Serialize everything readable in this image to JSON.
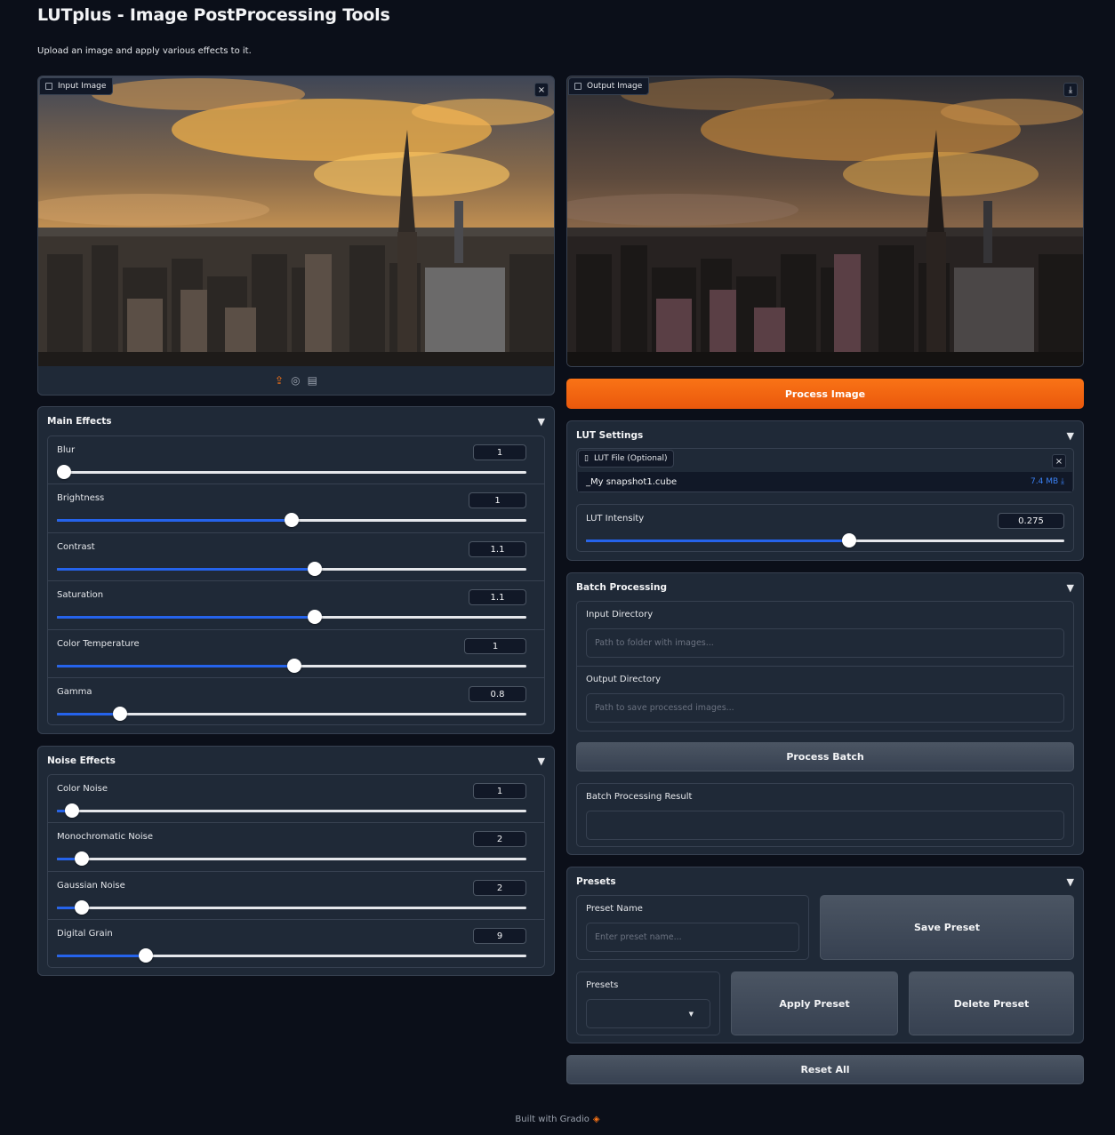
{
  "header": {
    "title": "LUTplus - Image PostProcessing Tools",
    "subtitle": "Upload an image and apply various effects to it."
  },
  "input_image": {
    "label": "Input Image",
    "close_icon": "×"
  },
  "output_image": {
    "label": "Output Image",
    "download_icon": "⤓"
  },
  "upload_icons": [
    "upload-icon",
    "webcam-icon",
    "clipboard-icon"
  ],
  "process_image_label": "Process Image",
  "main_effects": {
    "title": "Main Effects",
    "sliders": [
      {
        "label": "Blur",
        "value": "1",
        "fraction": 0.0
      },
      {
        "label": "Brightness",
        "value": "1",
        "fraction": 0.5
      },
      {
        "label": "Contrast",
        "value": "1.1",
        "fraction": 0.55
      },
      {
        "label": "Saturation",
        "value": "1.1",
        "fraction": 0.55
      },
      {
        "label": "Color Temperature",
        "value": "1",
        "fraction": 0.505
      },
      {
        "label": "Gamma",
        "value": "0.8",
        "fraction": 0.135
      }
    ]
  },
  "noise_effects": {
    "title": "Noise Effects",
    "sliders": [
      {
        "label": "Color Noise",
        "value": "1",
        "fraction": 0.033
      },
      {
        "label": "Monochromatic Noise",
        "value": "2",
        "fraction": 0.053
      },
      {
        "label": "Gaussian Noise",
        "value": "2",
        "fraction": 0.053
      },
      {
        "label": "Digital Grain",
        "value": "9",
        "fraction": 0.189
      }
    ]
  },
  "lut_settings": {
    "title": "LUT Settings",
    "file_label": "LUT File (Optional)",
    "file_name": "_My snapshot1.cube",
    "file_size": "7.4 MB ⤓",
    "intensity_label": "LUT Intensity",
    "intensity_value": "0.275",
    "intensity_fraction": 0.55
  },
  "batch": {
    "title": "Batch Processing",
    "input_label": "Input Directory",
    "input_placeholder": "Path to folder with images...",
    "output_label": "Output Directory",
    "output_placeholder": "Path to save processed images...",
    "process_label": "Process Batch",
    "result_label": "Batch Processing Result",
    "result_value": ""
  },
  "presets": {
    "title": "Presets",
    "name_label": "Preset Name",
    "name_placeholder": "Enter preset name...",
    "save_label": "Save Preset",
    "dropdown_label": "Presets",
    "dropdown_value": "",
    "apply_label": "Apply Preset",
    "delete_label": "Delete Preset"
  },
  "reset_label": "Reset All",
  "footer": {
    "text": "Built with Gradio",
    "logo_icon": "gradio-logo-icon"
  },
  "colors": {
    "accent": "#f97316",
    "slider_fill": "#2563eb",
    "background": "#0b0f19",
    "panel": "#1f2937"
  }
}
